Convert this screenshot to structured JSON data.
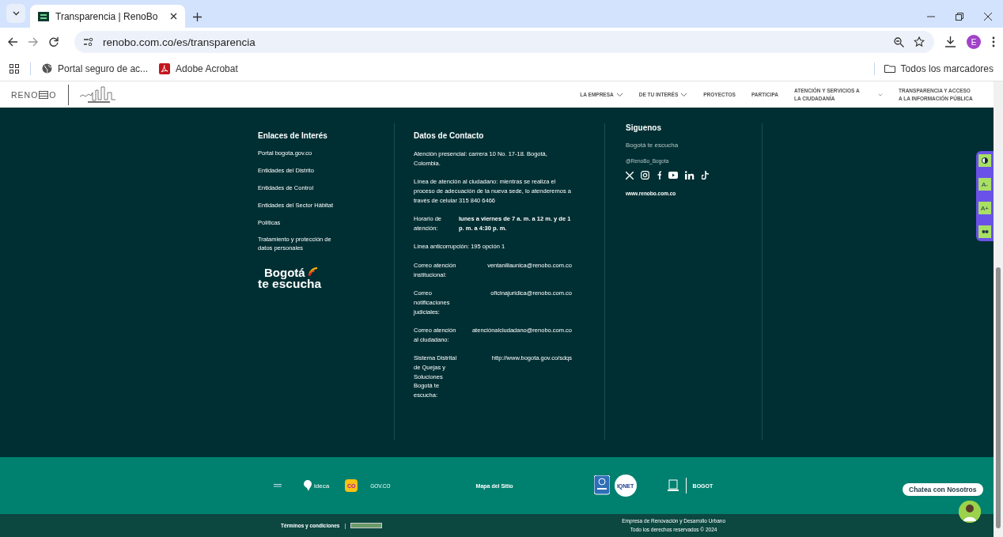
{
  "browser": {
    "tab_title": "Transparencia | RenoBo",
    "url": "renobo.com.co/es/transparencia",
    "profile_initial": "E",
    "bookmarks": [
      {
        "kind": "globe",
        "label": "Portal seguro de ac..."
      },
      {
        "kind": "pdf",
        "label": "Adobe Acrobat"
      }
    ],
    "all_bookmarks": "Todos los marcadores"
  },
  "site_header": {
    "logo": {
      "left": "RENO",
      "right": "O"
    },
    "nav": [
      {
        "label": "LA EMPRESA",
        "dropdown": true
      },
      {
        "label": "DE TU INTERÉS",
        "dropdown": true
      },
      {
        "label": "PROYECTOS",
        "dropdown": false
      },
      {
        "label": "PARTICIPA",
        "dropdown": false
      },
      {
        "label": "ATENCIÓN Y SERVICIOS A LA CIUDADANÍA",
        "dropdown": true
      },
      {
        "label": "TRANSPARENCIA Y ACCESO A LA INFORMACIÓN PÚBLICA",
        "dropdown": false
      }
    ]
  },
  "footer": {
    "links_column": {
      "heading": "Enlaces de Interés",
      "links": [
        "Portal bogota.gov.co",
        "Entidades del Distrito",
        "Entidades de Control",
        "Entidades del Sector Hábitat",
        "Políticas",
        "Tratamiento y protección de datos personales"
      ],
      "badge": {
        "line1": "Bogotá",
        "line2": "te escucha"
      }
    },
    "contact_column": {
      "heading": "Datos de Contacto",
      "items": [
        {
          "kind": "text",
          "text": "Atención presencial: carrera 10 No. 17-18. Bogotá, Colombia."
        },
        {
          "kind": "text",
          "text": "Línea de atención al ciudadano: mientras se realiza el proceso de adecuación de la nueva sede, lo atenderemos a través de celular 315 840 6466"
        },
        {
          "kind": "schedule",
          "label": "Horario de atención:",
          "value": "lunes a viernes de 7 a. m. a 12 m. y de 1 p. m. a 4:30 p. m."
        },
        {
          "kind": "text",
          "text": "Línea anticorrupción: 195 opción 1"
        },
        {
          "kind": "pair",
          "label": "Correo atención institucional:",
          "value": "ventanillaunica@renobo.com.co"
        },
        {
          "kind": "pair",
          "label": "Correo notificaciones judiciales:",
          "value": "oficinajuridica@renobo.com.co"
        },
        {
          "kind": "pair",
          "label": "Correo atención al ciudadano:",
          "value": "atenciónalciudadano@renobo.com.co"
        },
        {
          "kind": "pair",
          "label": "Sistema Distrital de Quejas y Soluciones Bogotá te escucha:",
          "value": "http://www.bogota.gov.co/sdqs"
        }
      ]
    },
    "social_column": {
      "heading": "Siguenos",
      "subtitle": "Bogotá te escucha",
      "handle": "@RenoBo_Bogota",
      "website": "www.renobo.com.co"
    }
  },
  "accessibility_tools": [
    {
      "kind": "contrast"
    },
    {
      "kind": "text",
      "label": "A-"
    },
    {
      "kind": "text",
      "label": "A+"
    },
    {
      "kind": "icon"
    }
  ],
  "partners_band": {
    "ideca": "ideca",
    "colombia": "CO",
    "govco": "GOV.CO",
    "sitemap": "Mapa del Sitio",
    "iqnet": "IQNET",
    "bogota": "BOGOT"
  },
  "chat": {
    "label": "Chatea con Nosotros"
  },
  "bottom_bar": {
    "terms": "Términos y condiciones",
    "separator": "|",
    "company": "Empresa de Renovación y Desarrollo Urbano",
    "rights": "Todo los derechos reservados © 2024"
  }
}
